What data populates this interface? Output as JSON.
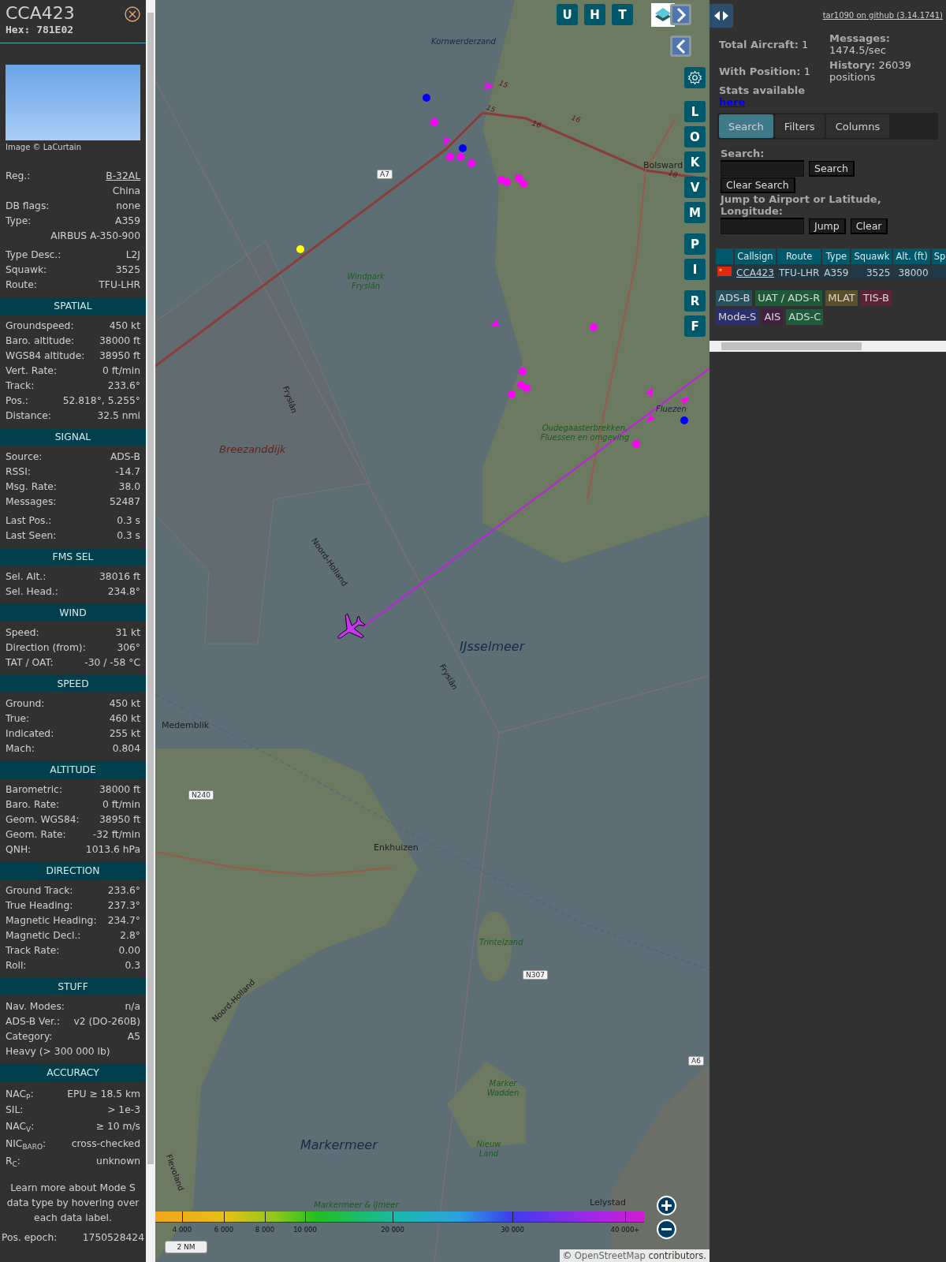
{
  "aircraft": {
    "callsign": "CCA423",
    "hex": "Hex: 781E02",
    "photo_credit": "Image © LaCurtain"
  },
  "details": [
    [
      {
        "kind": "link",
        "label": "Reg.:",
        "value": "B-32AL"
      },
      {
        "kind": "value",
        "value": "China"
      },
      {
        "kind": "pair",
        "label": "DB flags:",
        "value": "none"
      },
      {
        "kind": "pair",
        "label": "Type:",
        "value": "A359"
      },
      {
        "kind": "value",
        "value": "AIRBUS A-350-900"
      }
    ],
    [
      {
        "kind": "pair",
        "label": "Type Desc.:",
        "value": "L2J"
      },
      {
        "kind": "pair",
        "label": "Squawk:",
        "value": "3525"
      },
      {
        "kind": "pair",
        "label": "Route:",
        "value": "TFU-LHR"
      }
    ]
  ],
  "sections": [
    {
      "title": "SPATIAL",
      "groups": [
        [
          {
            "kind": "pair",
            "label": "Groundspeed:",
            "value": "450 kt"
          },
          {
            "kind": "pair",
            "label": "Baro. altitude:",
            "value": "38000 ft"
          },
          {
            "kind": "pair",
            "label": "WGS84 altitude:",
            "value": "38950 ft"
          },
          {
            "kind": "pair",
            "label": "Vert. Rate:",
            "value": "0 ft/min"
          },
          {
            "kind": "pair",
            "label": "Track:",
            "value": "233.6°"
          },
          {
            "kind": "pair",
            "label": "Pos.:",
            "value": "52.818°, 5.255°"
          },
          {
            "kind": "pair",
            "label": "Distance:",
            "value": "32.5 nmi"
          }
        ]
      ]
    },
    {
      "title": "SIGNAL",
      "groups": [
        [
          {
            "kind": "pair",
            "label": "Source:",
            "value": "ADS-B"
          },
          {
            "kind": "pair",
            "label": "RSSI:",
            "value": "-14.7"
          },
          {
            "kind": "pair",
            "label": "Msg. Rate:",
            "value": "38.0"
          },
          {
            "kind": "pair",
            "label": "Messages:",
            "value": "52487"
          }
        ],
        [
          {
            "kind": "pair",
            "label": "Last Pos.:",
            "value": "0.3 s"
          },
          {
            "kind": "pair",
            "label": "Last Seen:",
            "value": "0.3 s"
          }
        ]
      ]
    },
    {
      "title": "FMS SEL",
      "groups": [
        [
          {
            "kind": "pair",
            "label": "Sel. Alt.:",
            "value": "38016 ft"
          },
          {
            "kind": "pair",
            "label": "Sel. Head.:",
            "value": "234.8°"
          }
        ]
      ]
    },
    {
      "title": "WIND",
      "groups": [
        [
          {
            "kind": "pair",
            "label": "Speed:",
            "value": "31 kt"
          },
          {
            "kind": "pair",
            "label": "Direction (from):",
            "value": "306°"
          },
          {
            "kind": "pair",
            "label": "TAT / OAT:",
            "value": "-30 / -58 °C"
          }
        ]
      ]
    },
    {
      "title": "SPEED",
      "groups": [
        [
          {
            "kind": "pair",
            "label": "Ground:",
            "value": "450 kt"
          },
          {
            "kind": "pair",
            "label": "True:",
            "value": "460 kt"
          },
          {
            "kind": "pair",
            "label": "Indicated:",
            "value": "255 kt"
          },
          {
            "kind": "pair",
            "label": "Mach:",
            "value": "0.804"
          }
        ]
      ]
    },
    {
      "title": "ALTITUDE",
      "groups": [
        [
          {
            "kind": "pair",
            "label": "Barometric:",
            "value": "38000 ft"
          },
          {
            "kind": "pair",
            "label": "Baro. Rate:",
            "value": "0 ft/min"
          },
          {
            "kind": "pair",
            "label": "Geom. WGS84:",
            "value": "38950 ft"
          },
          {
            "kind": "pair",
            "label": "Geom. Rate:",
            "value": "-32 ft/min"
          },
          {
            "kind": "pair",
            "label": "QNH:",
            "value": "1013.6 hPa"
          }
        ]
      ]
    },
    {
      "title": "DIRECTION",
      "groups": [
        [
          {
            "kind": "pair",
            "label": "Ground Track:",
            "value": "233.6°"
          },
          {
            "kind": "pair",
            "label": "True Heading:",
            "value": "237.3°"
          },
          {
            "kind": "pair",
            "label": "Magnetic Heading:",
            "value": "234.7°"
          },
          {
            "kind": "pair",
            "label": "Magnetic Decl.:",
            "value": "2.8°"
          },
          {
            "kind": "pair",
            "label": "Track Rate:",
            "value": "0.00"
          },
          {
            "kind": "pair",
            "label": "Roll:",
            "value": "0.3"
          }
        ]
      ]
    },
    {
      "title": "STUFF",
      "groups": [
        [
          {
            "kind": "pair",
            "label": "Nav. Modes:",
            "value": "n/a"
          },
          {
            "kind": "pair",
            "label": "ADS-B Ver.:",
            "value": "v2 (DO-260B)"
          },
          {
            "kind": "pair",
            "label": "Category:",
            "value": "A5"
          },
          {
            "kind": "text",
            "label": "Heavy (> 300 000 lb)"
          }
        ]
      ]
    },
    {
      "title": "ACCURACY",
      "groups": [
        [
          {
            "kind": "pair",
            "label": "NAC$_{P}$:",
            "value": "EPU ≥ 18.5 km"
          },
          {
            "kind": "pair",
            "label": "SIL:",
            "value": "> 1e-3"
          },
          {
            "kind": "pair",
            "label": "NAC$_{V}$:",
            "value": "≥ 10 m/s"
          },
          {
            "kind": "pair",
            "label": "NIC$_{BARO}$:",
            "value": "cross-checked"
          },
          {
            "kind": "pair",
            "label": "R$_{C}$:",
            "value": "unknown"
          }
        ]
      ]
    }
  ],
  "note": "Learn more about Mode S data type by hovering over each data label.",
  "footer_row": {
    "label": "Pos. epoch:",
    "value": "1750528424"
  },
  "map": {
    "top_buttons": [
      "U",
      "H",
      "T"
    ],
    "side_buttons": [
      "L",
      "O",
      "K",
      "V",
      "M",
      "P",
      "I",
      "R",
      "F"
    ],
    "labels": [
      {
        "kind": "water",
        "text": "Kornwerderzand"
      },
      {
        "kind": "shield",
        "text": "A7"
      },
      {
        "kind": "nature",
        "text": "Windpark Fryslân"
      },
      {
        "kind": "locality",
        "text": "Breezanddijk"
      },
      {
        "kind": "boundary",
        "text": "Fryslân"
      },
      {
        "kind": "boundary",
        "text": "Noord-Holland"
      },
      {
        "kind": "water",
        "text": "IJsselmeer"
      },
      {
        "kind": "boundary",
        "text": "Fryslân"
      },
      {
        "kind": "place",
        "text": "Medemblik"
      },
      {
        "kind": "shield",
        "text": "N240"
      },
      {
        "kind": "place",
        "text": "Enkhuizen"
      },
      {
        "kind": "nature",
        "text": "Trintelzand"
      },
      {
        "kind": "shield",
        "text": "N307"
      },
      {
        "kind": "nature",
        "text": "Marker Wadden"
      },
      {
        "kind": "water",
        "text": "Markermeer"
      },
      {
        "kind": "nature",
        "text": "Nieuw Land"
      },
      {
        "kind": "nature",
        "text": "Markermeer & IJmeer"
      },
      {
        "kind": "place",
        "text": "Lelystad"
      },
      {
        "kind": "place",
        "text": "Bolsward"
      },
      {
        "kind": "nature",
        "text": "Oudegaasterbrekken, Fluessen en omgeving"
      },
      {
        "kind": "water",
        "text": "Fluezen"
      },
      {
        "kind": "boundary",
        "text": "Flevoland"
      },
      {
        "kind": "boundary",
        "text": "Noord-Holland"
      },
      {
        "kind": "roadnum",
        "text": "15"
      },
      {
        "kind": "roadnum",
        "text": "15"
      },
      {
        "kind": "roadnum",
        "text": "16"
      },
      {
        "kind": "roadnum",
        "text": "16"
      },
      {
        "kind": "roadnum",
        "text": "18"
      },
      {
        "kind": "shield",
        "text": "A6"
      }
    ],
    "altitude_legend": [
      "4 000",
      "6 000",
      "8 000",
      "10 000",
      "20 000",
      "30 000",
      "40 000+"
    ],
    "scale": "2 NM",
    "attribution": {
      "prefix": "©",
      "link": "OpenStreetMap",
      "suffix": "contributors."
    }
  },
  "right_panel": {
    "github_link": "tar1090 on github (3.14.1741)",
    "stats": [
      {
        "label": "Total Aircraft:",
        "value": "1"
      },
      {
        "label": "With Position:",
        "value": "1"
      },
      {
        "label": "Messages:",
        "value": "1474.5/sec"
      },
      {
        "label": "History:",
        "value": "26039 positions"
      }
    ],
    "stats_text": "Stats available",
    "stats_link": "here",
    "tabs": [
      {
        "label": "Search",
        "selected": true
      },
      {
        "label": "Filters",
        "selected": false
      },
      {
        "label": "Columns",
        "selected": false
      }
    ],
    "search_label": "Search:",
    "search_button": "Search",
    "clear_search_button": "Clear Search",
    "jump_label": "Jump to Airport or Latitude, Longitude:",
    "jump_button": "Jump",
    "clear_button": "Clear",
    "table": {
      "columns": [
        "Callsign",
        "Route",
        "Type",
        "Squawk",
        "Alt. (ft)",
        "Sp"
      ],
      "rows": [
        {
          "cells": [
            "CCA423",
            "TFU-LHR",
            "A359",
            "3525",
            "38000"
          ]
        }
      ]
    },
    "sources": [
      {
        "label": "ADS-B",
        "color": "#27505f"
      },
      {
        "label": "UAT / ADS-R",
        "color": "#1f5a38"
      },
      {
        "label": "MLAT",
        "color": "#5a4f2a"
      },
      {
        "label": "TIS-B",
        "color": "#5c2236"
      },
      {
        "label": "Mode-S",
        "color": "#2c2f6e"
      },
      {
        "label": "AIS",
        "color": "#43203f"
      },
      {
        "label": "ADS-C",
        "color": "#1f5b3a"
      }
    ]
  }
}
